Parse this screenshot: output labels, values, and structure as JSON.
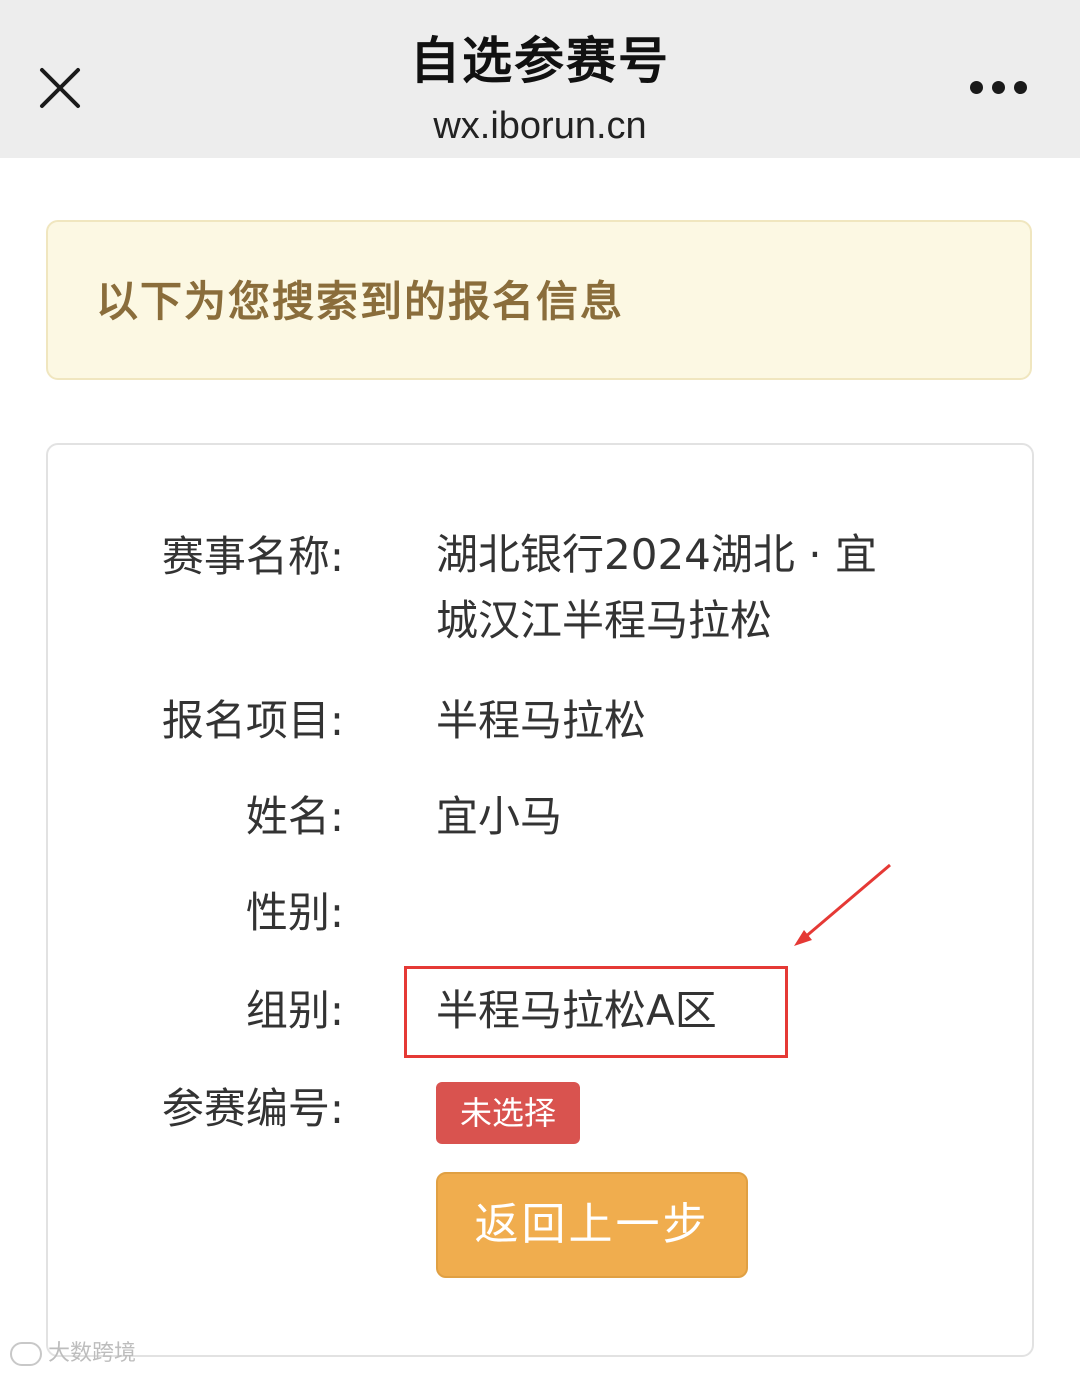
{
  "header": {
    "title": "自选参赛号",
    "url": "wx.iborun.cn",
    "close_icon": "close-icon",
    "more_icon": "more-horizontal-icon"
  },
  "notice": {
    "text": "以下为您搜索到的报名信息",
    "bg_color": "#fcf8e3",
    "text_color": "#8a6d3b"
  },
  "info": {
    "event_label": "赛事名称:",
    "event_value_line1": "湖北银行2024湖北 · 宜",
    "event_value_line2": "城汉江半程马拉松",
    "project_label": "报名项目:",
    "project_value": "半程马拉松",
    "name_label": "姓名:",
    "name_value": "宜小马",
    "gender_label": "性别:",
    "gender_value": "",
    "group_label": "组别:",
    "group_value": "半程马拉松A区",
    "bib_label": "参赛编号:",
    "bib_status": "未选择"
  },
  "actions": {
    "back_label": "返回上一步"
  },
  "annotation": {
    "highlight_color": "#e53935"
  },
  "watermark": {
    "text": "大数跨境"
  },
  "colors": {
    "badge_red": "#d9534f",
    "button_orange": "#f0ad4e",
    "topbar_gray": "#ededed"
  }
}
